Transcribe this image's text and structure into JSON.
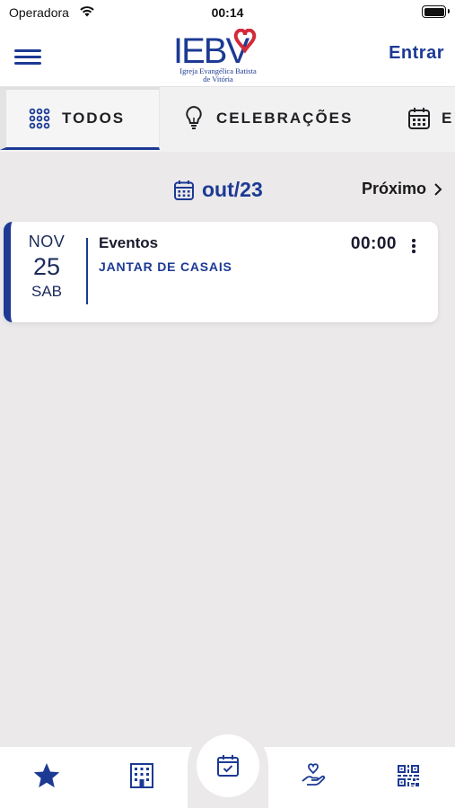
{
  "status_bar": {
    "carrier": "Operadora",
    "time": "00:14"
  },
  "header": {
    "logo": {
      "wordmark": "IEBV",
      "line1": "Igreja Evangélica Batista",
      "line2": "de Vitória"
    },
    "login_label": "Entrar"
  },
  "tabs": [
    {
      "label": "TODOS",
      "icon": "grid-dots-icon",
      "active": true
    },
    {
      "label": "CELEBRAÇÕES",
      "icon": "lightbulb-icon",
      "active": false
    },
    {
      "label": "E",
      "icon": "calendar-icon",
      "active": false
    }
  ],
  "month_nav": {
    "current": "out/23",
    "next_label": "Próximo"
  },
  "events": [
    {
      "month": "NOV",
      "day": "25",
      "weekday": "SAB",
      "category": "Eventos",
      "title": "JANTAR DE CASAIS",
      "time": "00:00"
    }
  ],
  "bottom_nav": [
    {
      "icon": "star-icon"
    },
    {
      "icon": "building-icon"
    },
    {
      "icon": "calendar-check-icon",
      "active": true
    },
    {
      "icon": "heart-hand-icon"
    },
    {
      "icon": "qr-code-icon"
    }
  ],
  "colors": {
    "brand_blue": "#1c3a94",
    "accent_red": "#d32a3a",
    "background": "#ebe9ea"
  }
}
